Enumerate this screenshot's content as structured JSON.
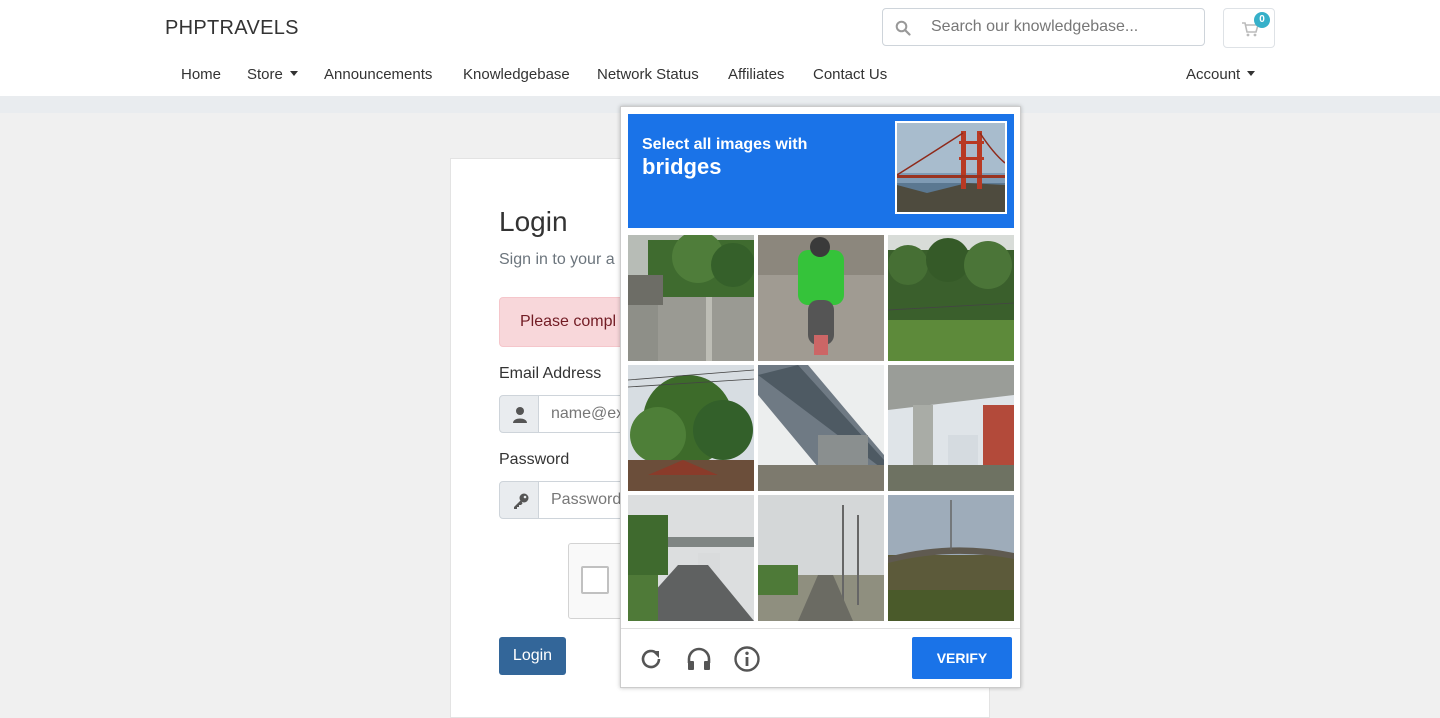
{
  "header": {
    "brand": "PHPTRAVELS",
    "search_placeholder": "Search our knowledgebase...",
    "cart_count": "0",
    "nav": [
      {
        "label": "Home"
      },
      {
        "label": "Store"
      },
      {
        "label": "Announcements"
      },
      {
        "label": "Knowledgebase"
      },
      {
        "label": "Network Status"
      },
      {
        "label": "Affiliates"
      },
      {
        "label": "Contact Us"
      }
    ],
    "account_label": "Account"
  },
  "login": {
    "title": "Login",
    "subtitle": "Sign in to your a",
    "alert": "Please compl",
    "email_label": "Email Address",
    "email_placeholder": "name@ex",
    "password_label": "Password",
    "password_placeholder": "Password",
    "submit_label": "Login"
  },
  "captcha": {
    "prompt_line1": "Select all images with",
    "prompt_target": "bridges",
    "verify_label": "VERIFY",
    "accent_color": "#1a73e8",
    "tiles": [
      "wall-with-trees",
      "scooter-rider",
      "trees-and-field",
      "tree-and-wires",
      "highway-overpass-side",
      "elevated-bridge-support",
      "overpass-with-truck",
      "street-with-lamps",
      "overpass-over-field"
    ],
    "footer_icons": [
      "reload-icon",
      "audio-icon",
      "info-icon"
    ]
  }
}
